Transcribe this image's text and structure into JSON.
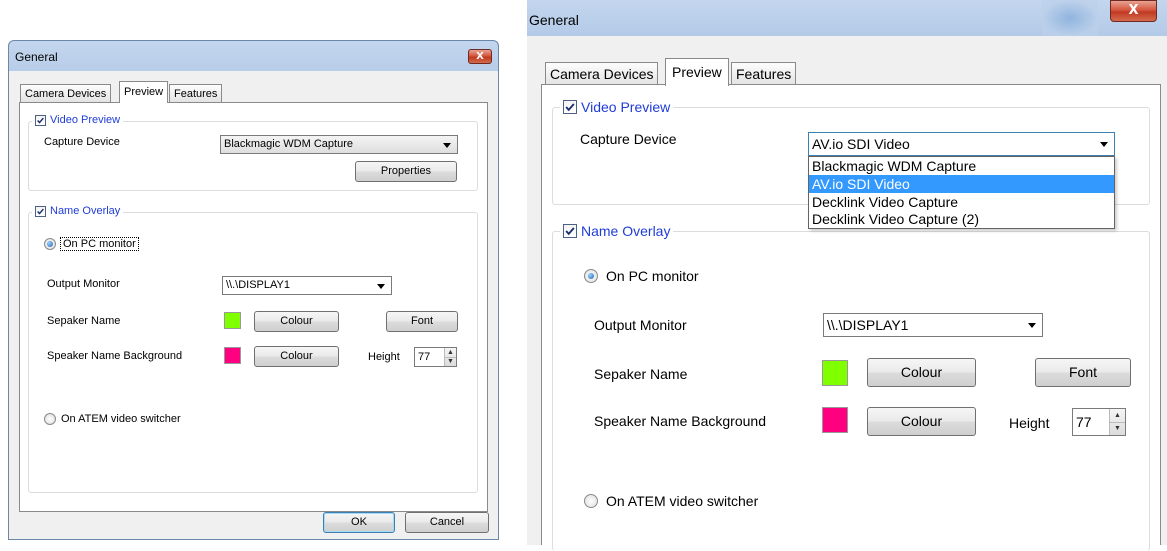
{
  "dialog": {
    "title": "General",
    "close_glyph": "X",
    "tabs": [
      "Camera Devices",
      "Preview",
      "Features"
    ],
    "active_tab": "Preview",
    "video_preview": {
      "label": "Video Preview",
      "checked": true,
      "capture_device_label": "Capture Device",
      "properties_button": "Properties"
    },
    "name_overlay": {
      "label": "Name Overlay",
      "checked": true,
      "on_pc_monitor": "On PC monitor",
      "output_monitor_label": "Output Monitor",
      "output_monitor_value": "\\\\.\\DISPLAY1",
      "speaker_name_label": "Sepaker Name",
      "speaker_name_color": "#80ff00",
      "colour_button": "Colour",
      "font_button": "Font",
      "speaker_bg_label": "Speaker Name Background",
      "speaker_bg_color": "#ff0080",
      "height_label": "Height",
      "height_value": "77",
      "on_atem": "On ATEM video switcher"
    },
    "ok_button": "OK",
    "cancel_button": "Cancel"
  },
  "left": {
    "capture_device_value": "Blackmagic WDM Capture"
  },
  "right": {
    "capture_device_value": "AV.io SDI Video",
    "capture_device_options": [
      "Blackmagic WDM Capture",
      "AV.io SDI Video",
      "Decklink Video Capture",
      "Decklink Video Capture (2)"
    ],
    "selected_option": "AV.io SDI Video"
  },
  "colors": {
    "accent_blue": "#1f3dd6",
    "selection": "#3399ff"
  },
  "icons": [
    "close-icon",
    "checkbox-checked-icon",
    "dropdown-arrow-icon",
    "radio-selected-icon",
    "radio-unselected-icon",
    "spin-up-icon",
    "spin-down-icon"
  ]
}
